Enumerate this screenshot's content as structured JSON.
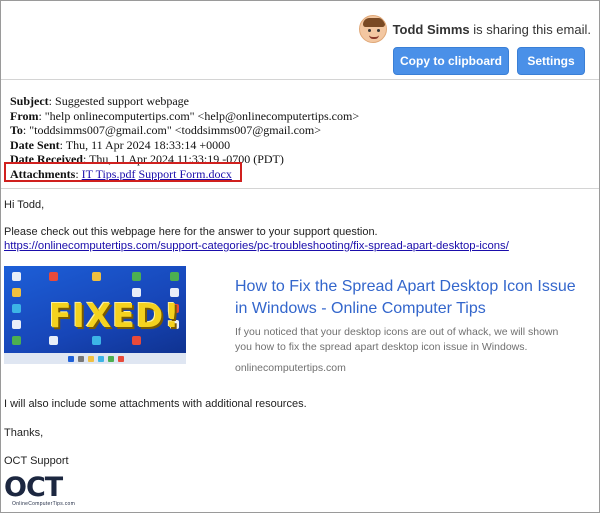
{
  "share": {
    "avatar_icon": "user-avatar-icon",
    "name": "Todd Simms",
    "suffix": " is sharing this email.",
    "copy_button": "Copy to clipboard",
    "settings_button": "Settings",
    "accent": "#4a90e8"
  },
  "headers": {
    "subject_label": "Subject",
    "subject": "Suggested support webpage",
    "from_label": "From",
    "from": "\"help onlinecomputertips.com\" <help@onlinecomputertips.com>",
    "to_label": "To",
    "to": "\"toddsimms007@gmail.com\" <toddsimms007@gmail.com>",
    "date_sent_label": "Date Sent",
    "date_sent": "Thu, 11 Apr 2024 18:33:14 +0000",
    "date_received_label": "Date Received",
    "date_received": "Thu, 11 Apr 2024 11:33:19 -0700 (PDT)",
    "attachments_label": "Attachments",
    "attachments": [
      "IT Tips.pdf",
      "Support Form.docx"
    ],
    "highlight_color": "#d0201e"
  },
  "body": {
    "greeting": "Hi Todd,",
    "intro": "Please check out this webpage here for the answer to your support question.",
    "link": "https://onlinecomputertips.com/support-categories/pc-troubleshooting/fix-spread-apart-desktop-icons/",
    "followup": "I will also include some attachments with additional resources.",
    "thanks": "Thanks,",
    "sender": "OCT Support"
  },
  "preview": {
    "thumbnail_text": "FIXED!",
    "title": "How to Fix the Spread Apart Desktop Icon Issue in Windows - Online Computer Tips",
    "description": "If you noticed that your desktop icons are out of whack, we will shown you how to fix the spread apart desktop icon issue in Windows.",
    "domain": "onlinecomputertips.com"
  },
  "signature": {
    "logo_text": "OCT",
    "logo_tagline": "OnlineComputerTips.com"
  }
}
